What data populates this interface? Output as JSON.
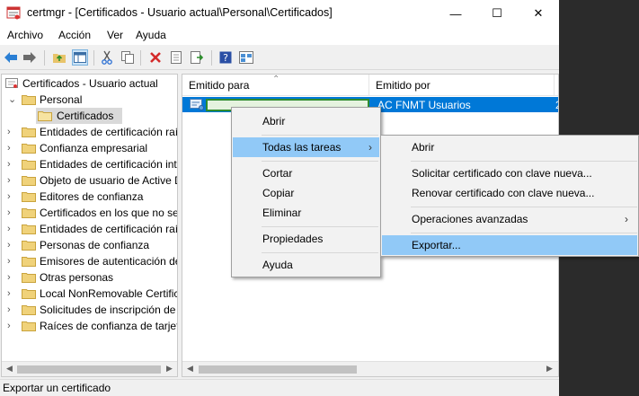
{
  "window": {
    "title": "certmgr - [Certificados - Usuario actual\\Personal\\Certificados]",
    "minimize_glyph": "—",
    "maximize_glyph": "☐",
    "close_glyph": "✕"
  },
  "menubar": {
    "items": [
      "Archivo",
      "Acción",
      "Ver",
      "Ayuda"
    ]
  },
  "toolbar": {
    "icons": [
      "back-arrow-icon",
      "forward-arrow-icon",
      "up-folder-icon",
      "show-hide-tree-icon",
      "cut-icon",
      "copy-icon",
      "delete-icon",
      "properties-icon",
      "export-list-icon",
      "help-icon",
      "mmc-view-icon"
    ]
  },
  "tree": {
    "root": "Certificados - Usuario actual",
    "personal": "Personal",
    "selected": "Certificados",
    "items": [
      "Entidades de certificación raí",
      "Confianza empresarial",
      "Entidades de certificación int",
      "Objeto de usuario de Active D",
      "Editores de confianza",
      "Certificados en los que no se",
      "Entidades de certificación raí",
      "Personas de confianza",
      "Emisores de autenticación de",
      "Otras personas",
      "Local NonRemovable Certific",
      "Solicitudes de inscripción de",
      "Raíces de confianza de tarjeta"
    ]
  },
  "list": {
    "columns": [
      "Emitido para",
      "Emitido por",
      "F"
    ],
    "selected_row": {
      "issued_to": "",
      "issued_by": "AC FNMT Usuarios",
      "extra": "2"
    }
  },
  "context_menu": {
    "items": [
      "Abrir",
      "Todas las tareas",
      "Cortar",
      "Copiar",
      "Eliminar",
      "Propiedades",
      "Ayuda"
    ],
    "submenu_arrow": "›"
  },
  "submenu": {
    "items": [
      "Abrir",
      "Solicitar certificado con clave nueva...",
      "Renovar certificado con clave nueva...",
      "Operaciones avanzadas",
      "Exportar..."
    ],
    "submenu_arrow": "›"
  },
  "statusbar": {
    "text": "Exportar un certificado"
  },
  "colors": {
    "selection": "#0078d7",
    "menu_highlight": "#91c9f7",
    "folder": "#e8c46a"
  }
}
